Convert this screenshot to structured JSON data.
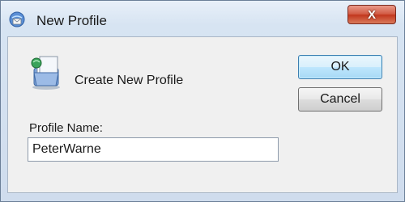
{
  "window": {
    "title": "New Profile",
    "close_label": "X",
    "app_icon": "mail-setup-icon"
  },
  "dialog": {
    "heading": "Create New Profile",
    "heading_icon": "profile-folder-icon",
    "ok_label": "OK",
    "cancel_label": "Cancel",
    "profile_name": {
      "label": "Profile Name:",
      "value": "PeterWarne"
    }
  },
  "colors": {
    "close_button": "#c2361d",
    "default_button_border": "#3c7fb1"
  }
}
